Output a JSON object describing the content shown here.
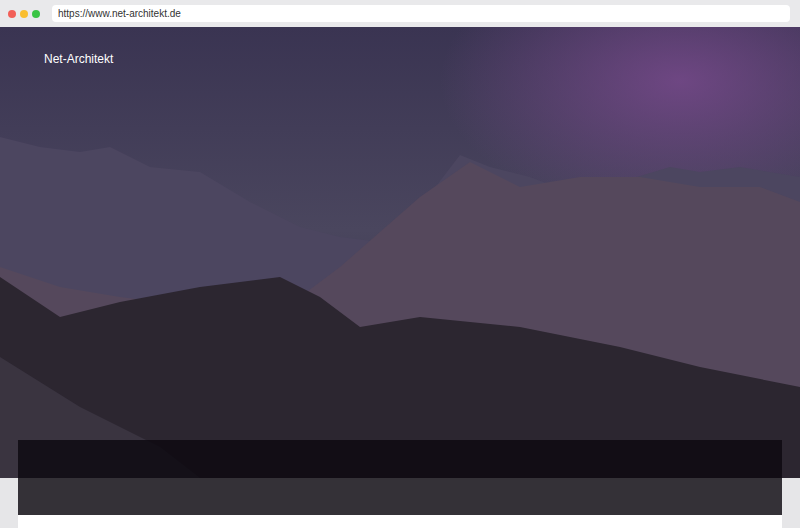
{
  "browser": {
    "url": "https://www.net-architekt.de"
  },
  "site": {
    "title": "Net-Architekt"
  }
}
